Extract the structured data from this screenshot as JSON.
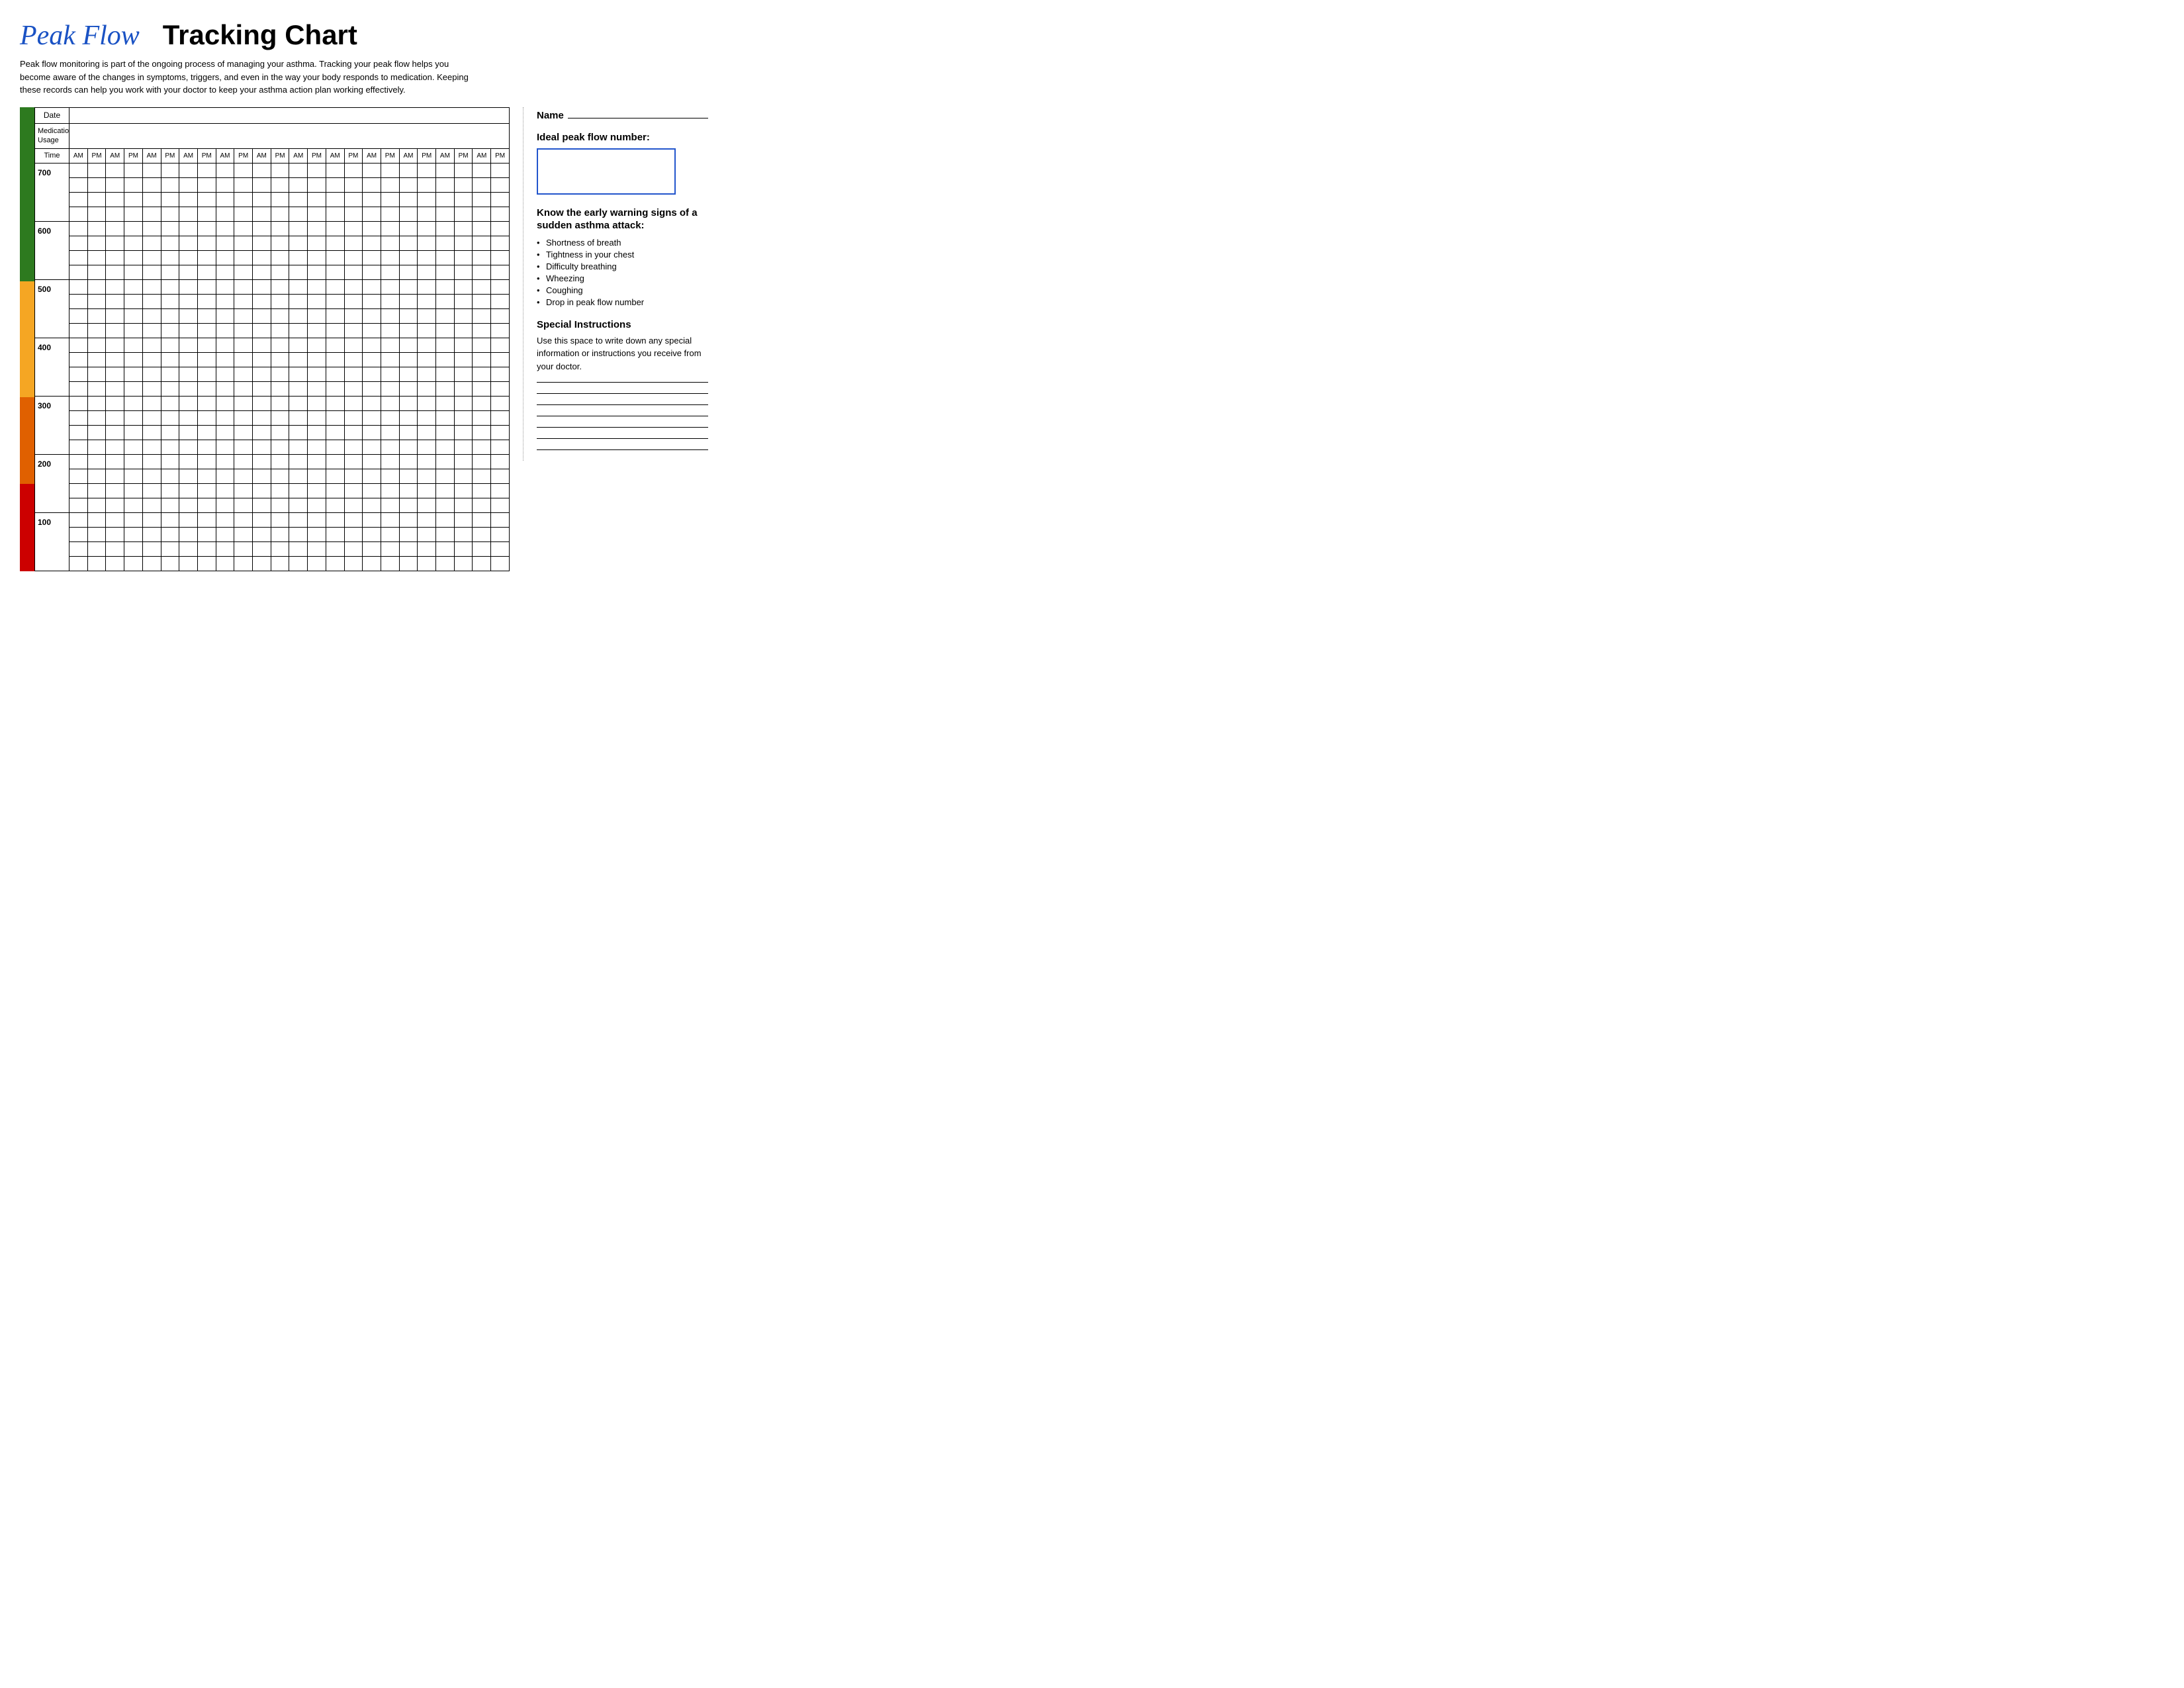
{
  "header": {
    "title_script": "Peak Flow",
    "title_bold": "Tracking Chart",
    "description": "Peak flow monitoring is part of the ongoing process of managing your asthma. Tracking your peak flow helps you become aware of the changes in symptoms, triggers, and even in the way your body responds to medication. Keeping these records can help you work with your doctor to keep your asthma action plan working effectively."
  },
  "chart": {
    "header_row": [
      "Date",
      "",
      "",
      "",
      "",
      "",
      "",
      "",
      "",
      "",
      "",
      "",
      "",
      "",
      "",
      "",
      "",
      "",
      "",
      "",
      "",
      "",
      "",
      "",
      ""
    ],
    "medication_label": "Medication\nUsage",
    "time_label": "Time",
    "time_cols": [
      "AM",
      "PM",
      "AM",
      "PM",
      "AM",
      "PM",
      "AM",
      "PM",
      "AM",
      "PM",
      "AM",
      "PM",
      "AM",
      "PM",
      "AM",
      "PM",
      "AM",
      "PM",
      "AM",
      "PM",
      "AM",
      "PM",
      "AM",
      "PM"
    ],
    "y_labels": [
      700,
      600,
      500,
      400,
      300,
      200,
      100
    ],
    "rows_per_section": 4
  },
  "sidebar": {
    "name_label": "Name",
    "ideal_label": "Ideal peak flow number:",
    "warning_title": "Know the early warning signs of a sudden asthma attack:",
    "warning_items": [
      "Shortness of breath",
      "Tightness in your chest",
      "Difficulty breathing",
      "Wheezing",
      "Coughing",
      "Drop in peak flow number"
    ],
    "special_title": "Special Instructions",
    "special_desc": "Use this space to write down any special information or instructions you receive from your doctor.",
    "write_lines": 7
  }
}
